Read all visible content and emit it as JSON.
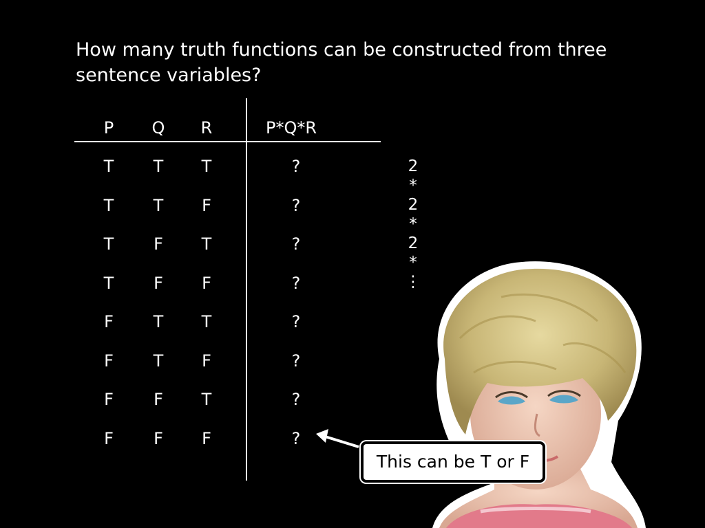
{
  "question": "How many truth functions can be constructed from three sentence variables?",
  "table": {
    "headers": [
      "P",
      "Q",
      "R",
      "P*Q*R"
    ],
    "rows": [
      [
        "T",
        "T",
        "T",
        "?"
      ],
      [
        "T",
        "T",
        "F",
        "?"
      ],
      [
        "T",
        "F",
        "T",
        "?"
      ],
      [
        "T",
        "F",
        "F",
        "?"
      ],
      [
        "F",
        "T",
        "T",
        "?"
      ],
      [
        "F",
        "T",
        "F",
        "?"
      ],
      [
        "F",
        "F",
        "T",
        "?"
      ],
      [
        "F",
        "F",
        "F",
        "?"
      ]
    ]
  },
  "multiplication": [
    "2",
    "*",
    "2",
    "*",
    "2",
    "*",
    "⋮"
  ],
  "callout": "This can be T or F",
  "colors": {
    "background": "#000000",
    "text": "#ffffff",
    "callout_bg": "#ffffff",
    "callout_text": "#000000"
  },
  "icons": {
    "pointer": "arrow-left-icon",
    "figure": "doll-photo"
  }
}
